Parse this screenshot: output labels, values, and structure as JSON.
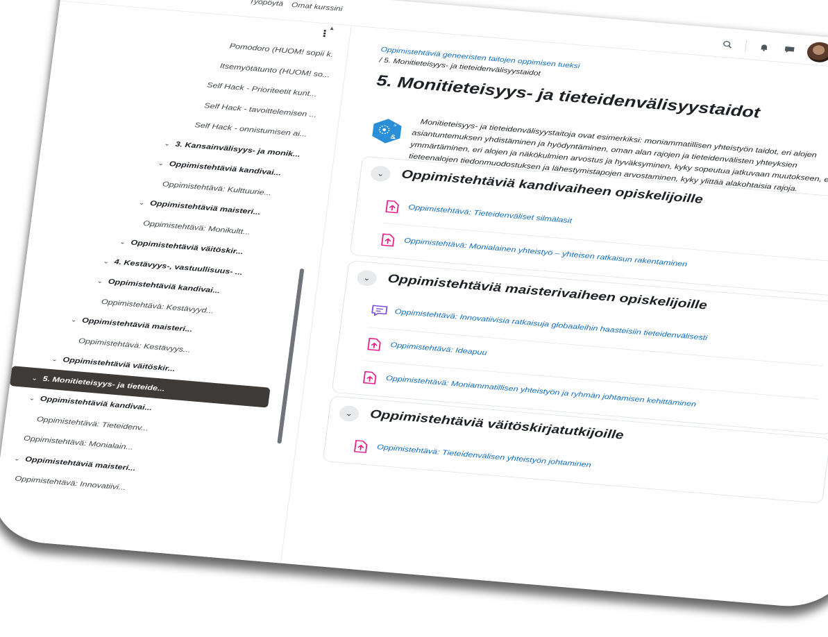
{
  "navbar": {
    "links": [
      "Työpöytä",
      "Omat kurssini"
    ]
  },
  "drawer": {
    "items": [
      {
        "label": "Pomodoro (HUOM! sopii k...",
        "kind": "act"
      },
      {
        "label": "Itsemyötätunto (HUOM! so...",
        "kind": "act"
      },
      {
        "label": "Self Hack - Prioriteetit kunt...",
        "kind": "act"
      },
      {
        "label": "Self Hack - tavoittelemisen ...",
        "kind": "act"
      },
      {
        "label": "Self Hack - onnistumisen ai...",
        "kind": "act"
      },
      {
        "label": "3. Kansainvälisyys- ja monik...",
        "kind": "sec"
      },
      {
        "label": "Oppimistehtäviä kandivai...",
        "kind": "sec"
      },
      {
        "label": "Oppimistehtävä: Kulttuurie...",
        "kind": "act"
      },
      {
        "label": "Oppimistehtäviä maisteri...",
        "kind": "sec"
      },
      {
        "label": "Oppimistehtävä: Monikultt...",
        "kind": "act"
      },
      {
        "label": "Oppimistehtäviä väitöskir...",
        "kind": "sec"
      },
      {
        "label": "4. Kestävyys-, vastuullisuus- ...",
        "kind": "sec"
      },
      {
        "label": "Oppimistehtäviä kandivai...",
        "kind": "sec"
      },
      {
        "label": "Oppimistehtävä: Kestävyyd...",
        "kind": "act"
      },
      {
        "label": "Oppimistehtäviä maisteri...",
        "kind": "sec"
      },
      {
        "label": "Oppimistehtävä: Kestävyys...",
        "kind": "act"
      },
      {
        "label": "Oppimistehtäviä väitöskir...",
        "kind": "sec"
      },
      {
        "label": "5. Monitieteisyys- ja tieteide...",
        "kind": "sec",
        "current": true
      },
      {
        "label": "Oppimistehtäviä kandivai...",
        "kind": "sec"
      },
      {
        "label": "Oppimistehtävä: Tieteidenv...",
        "kind": "act"
      },
      {
        "label": "Oppimistehtävä: Monialain...",
        "kind": "act"
      },
      {
        "label": "Oppimistehtäviä maisteri...",
        "kind": "sec"
      },
      {
        "label": "Oppimistehtävä: Innovatiivi...",
        "kind": "act"
      }
    ]
  },
  "breadcrumb": {
    "parent": "Oppimistehtäviä geneeristen taitojen oppimisen tueksi",
    "separator": "/",
    "current": "5. Monitieteisyys- ja tieteidenvälisyystaidot"
  },
  "page": {
    "title": "5. Monitieteisyys- ja tieteidenvälisyystaidot",
    "intro": "Monitieteisyys- ja tieteidenvälisyystaitoja ovat esimerkiksi: moniammatillisen yhteistyön taidot, eri alojen asiantuntemuksen yhdistäminen ja hyödyntäminen, oman alan rajojen ja tieteidenvälisten yhteyksien ymmärtäminen, eri alojen ja näkökulmien arvostus ja hyväksyminen, kyky sopeutua jatkuvaan muutokseen, eri tieteenalojen tiedonmuodostuksen ja lähestymistapojen arvostaminen, kyky ylittää alakohtaisia rajoja."
  },
  "sections": [
    {
      "title": "Oppimistehtäviä kandivaiheen opiskelijoille",
      "activities": [
        {
          "label": "Oppimistehtävä: Tieteidenväliset silmälasit",
          "icon": "assignment-icon"
        },
        {
          "label": "Oppimistehtävä: Monialainen yhteistyö – yhteisen ratkaisun rakentaminen",
          "icon": "assignment-icon"
        }
      ]
    },
    {
      "title": "Oppimistehtäviä maisterivaiheen opiskelijoille",
      "activities": [
        {
          "label": "Oppimistehtävä: Innovatiivisia ratkaisuja globaaleihin haasteisiin tieteidenvälisesti",
          "icon": "forum-icon"
        },
        {
          "label": "Oppimistehtävä: Ideapuu",
          "icon": "assignment-icon"
        },
        {
          "label": "Oppimistehtävä: Moniammatillisen yhteistyön ja ryhmän johtamisen kehittäminen",
          "icon": "assignment-icon"
        }
      ]
    },
    {
      "title": "Oppimistehtäviä väitöskirjatutkijoille",
      "activities": [
        {
          "label": "Oppimistehtävä: Tieteidenvälisen yhteistyön johtaminen",
          "icon": "assignment-icon"
        }
      ]
    }
  ],
  "colors": {
    "link": "#0f6cbf",
    "current_item_bg": "#3d3a37",
    "assignment_icon": "#e61e8c",
    "forum_icon": "#7b4bd6"
  }
}
